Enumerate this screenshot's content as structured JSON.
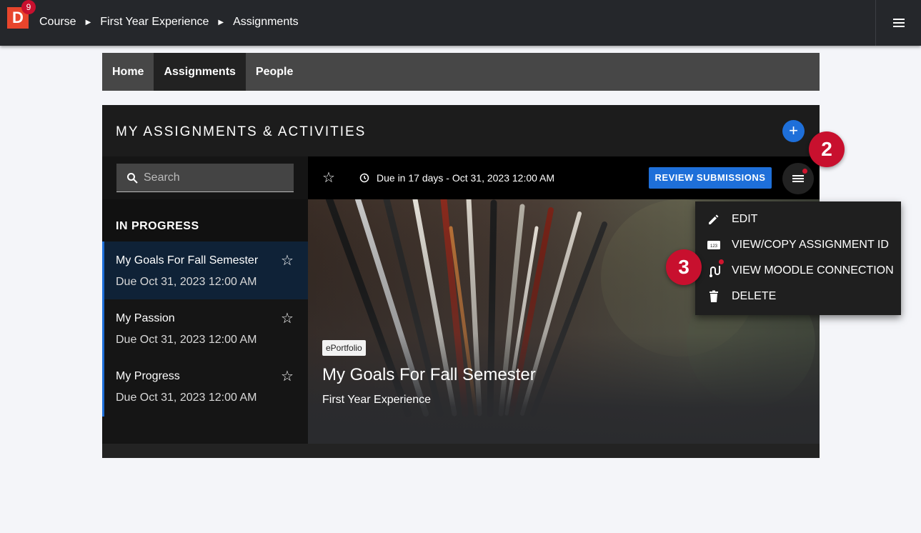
{
  "topbar": {
    "logo_letter": "D",
    "notification_count": "9",
    "breadcrumbs": [
      "Course",
      "First Year Experience",
      "Assignments"
    ],
    "menu_icon": "hamburger-menu-icon"
  },
  "tabs": [
    {
      "label": "Home",
      "active": false
    },
    {
      "label": "Assignments",
      "active": true
    },
    {
      "label": "People",
      "active": false
    }
  ],
  "panel": {
    "title": "MY ASSIGNMENTS & ACTIVITIES",
    "add_icon": "plus-icon"
  },
  "sidebar": {
    "search_placeholder": "Search",
    "section_title": "IN PROGRESS",
    "items": [
      {
        "title": "My Goals For Fall Semester",
        "due": "Due Oct 31, 2023 12:00 AM",
        "selected": true
      },
      {
        "title": "My Passion",
        "due": "Due Oct 31, 2023 12:00 AM",
        "selected": false
      },
      {
        "title": "My Progress",
        "due": "Due Oct 31, 2023 12:00 AM",
        "selected": false
      }
    ]
  },
  "detail": {
    "due_text": "Due in 17 days - Oct 31, 2023 12:00 AM",
    "review_button": "REVIEW SUBMISSIONS",
    "tag": "ePortfolio",
    "title": "My Goals For Fall Semester",
    "subtitle": "First Year Experience"
  },
  "context_menu": {
    "items": [
      {
        "label": "EDIT",
        "icon": "pencil-icon"
      },
      {
        "label": "VIEW/COPY ASSIGNMENT ID",
        "icon": "id-number-icon"
      },
      {
        "label": "VIEW MOODLE CONNECTION",
        "icon": "connection-icon"
      },
      {
        "label": "DELETE",
        "icon": "trash-icon"
      }
    ]
  },
  "steps": [
    "2",
    "3"
  ],
  "colors": {
    "accent_blue": "#1e6fd9",
    "brand_orange": "#e8452c",
    "badge_red": "#c8102e"
  }
}
